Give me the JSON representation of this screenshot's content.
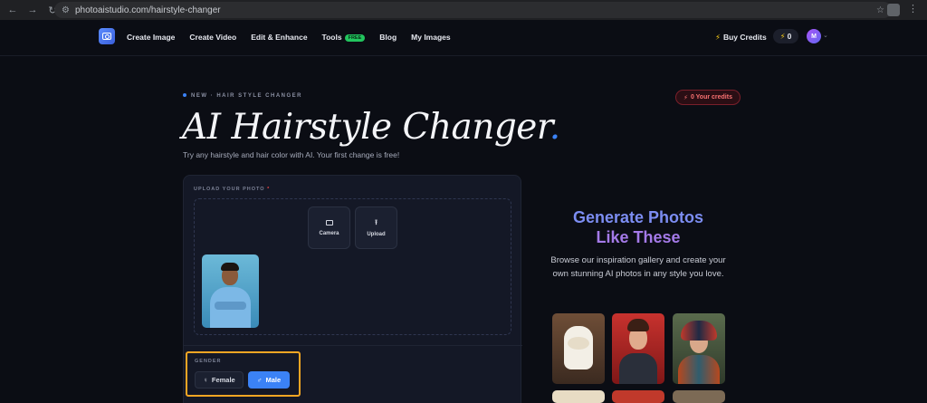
{
  "browser": {
    "url": "photoaistudio.com/hairstyle-changer"
  },
  "nav": {
    "links": [
      "Create Image",
      "Create Video",
      "Edit & Enhance",
      "Tools",
      "Blog",
      "My Images"
    ],
    "tools_badge": "FREE",
    "buy_credits": "Buy Credits",
    "credit_count": "0",
    "avatar_initial": "M"
  },
  "hero": {
    "eyebrow": "NEW · HAIR STYLE CHANGER",
    "credits_badge": "0 Your credits",
    "title": "AI Hairstyle Changer",
    "title_accent": ".",
    "subtitle": "Try any hairstyle and hair color with AI. Your first change is free!"
  },
  "upload": {
    "label": "UPLOAD YOUR PHOTO",
    "required_mark": "*",
    "camera_label": "Camera",
    "upload_label": "Upload"
  },
  "gender": {
    "label": "GENDER",
    "female": "Female",
    "male": "Male",
    "selected": "Male"
  },
  "promo": {
    "title_line1": "Generate Photos",
    "title_line2": "Like These",
    "subtitle": "Browse our inspiration gallery and create your own stunning AI photos in any style you love."
  },
  "colors": {
    "accent": "#3b82f6",
    "highlight": "#f5a623",
    "credit_badge": "#f87171",
    "free_badge": "#22c55e"
  }
}
